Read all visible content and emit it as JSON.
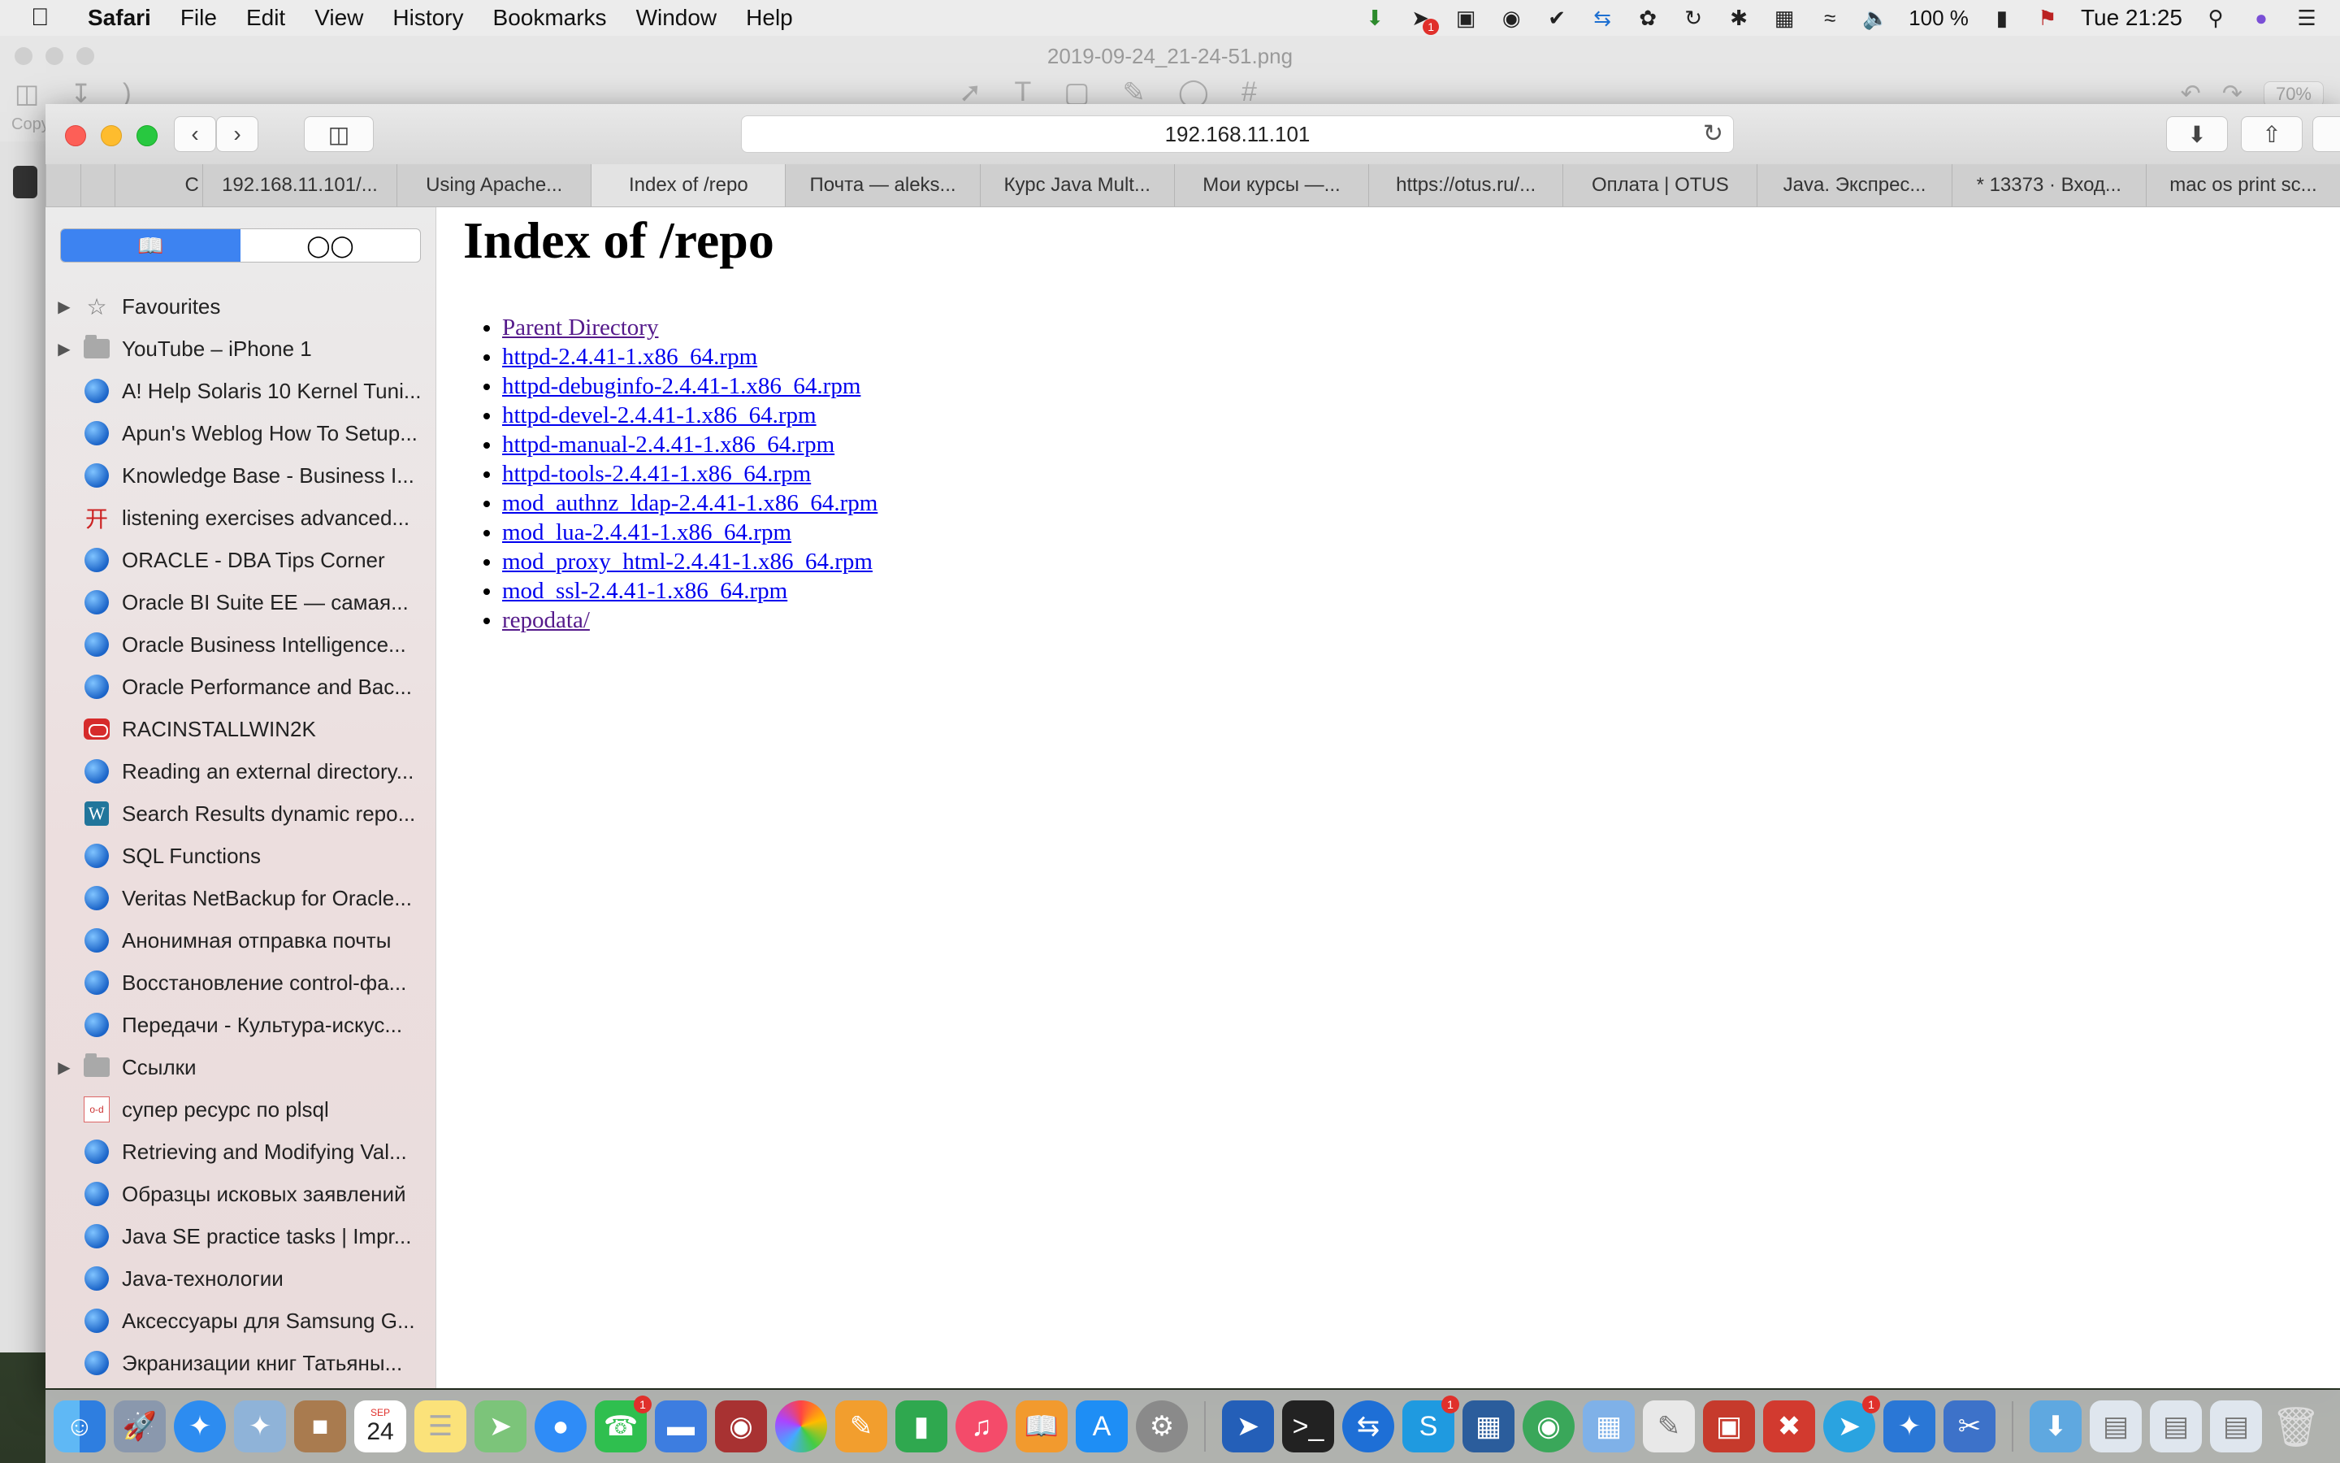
{
  "menubar": {
    "app": "Safari",
    "items": [
      "File",
      "Edit",
      "View",
      "History",
      "Bookmarks",
      "Window",
      "Help"
    ],
    "battery": "100 %",
    "clock": "Tue 21:25",
    "notification_badge": "1"
  },
  "preview": {
    "title": "2019-09-24_21-24-51.png",
    "zoom": "70%",
    "copy_label": "Copy"
  },
  "safari": {
    "address": "192.168.11.101",
    "tabs": [
      "C",
      "192.168.11.101/...",
      "Using Apache...",
      "Index of /repo",
      "Почта — aleks...",
      "Курс Java Mult...",
      "Мои курсы —...",
      "https://otus.ru/...",
      "Оплата | OTUS",
      "Java. Экспрес...",
      "* 13373 · Вход...",
      "mac os print sc..."
    ],
    "active_tab_index": 3
  },
  "sidebar": {
    "items": [
      {
        "label": "Favourites",
        "icon": "star-icon",
        "expandable": true
      },
      {
        "label": "YouTube – iPhone 1",
        "icon": "folder-icon",
        "expandable": true
      },
      {
        "label": "A! Help Solaris 10 Kernel Tuni...",
        "icon": "globe-icon"
      },
      {
        "label": "Apun's Weblog How To Setup...",
        "icon": "globe-icon"
      },
      {
        "label": "Knowledge Base - Business I...",
        "icon": "globe-icon"
      },
      {
        "label": "listening exercises advanced...",
        "icon": "fr-icon"
      },
      {
        "label": "ORACLE - DBA Tips Corner",
        "icon": "globe-icon"
      },
      {
        "label": "Oracle BI Suite EE — самая...",
        "icon": "globe-icon"
      },
      {
        "label": "Oracle Business Intelligence...",
        "icon": "globe-icon"
      },
      {
        "label": "Oracle Performance and Bac...",
        "icon": "globe-icon"
      },
      {
        "label": "RACINSTALLWIN2K",
        "icon": "oracle-icon"
      },
      {
        "label": "Reading an external directory...",
        "icon": "globe-icon"
      },
      {
        "label": "Search Results dynamic repo...",
        "icon": "wordpress-icon"
      },
      {
        "label": "SQL Functions",
        "icon": "globe-icon"
      },
      {
        "label": "Veritas NetBackup for Oracle...",
        "icon": "globe-icon"
      },
      {
        "label": "Анонимная отправка почты",
        "icon": "globe-icon"
      },
      {
        "label": "Восстановление control-фа...",
        "icon": "globe-icon"
      },
      {
        "label": "Передачи - Культура-искус...",
        "icon": "globe-icon"
      },
      {
        "label": "Ссылки",
        "icon": "folder-icon",
        "expandable": true
      },
      {
        "label": "супер ресурс по plsql",
        "icon": "od-icon"
      },
      {
        "label": "Retrieving and Modifying Val...",
        "icon": "globe-icon"
      },
      {
        "label": "Образцы исковых заявлений",
        "icon": "globe-icon"
      },
      {
        "label": "Java SE practice tasks | Impr...",
        "icon": "globe-icon"
      },
      {
        "label": "Java-технологии",
        "icon": "globe-icon"
      },
      {
        "label": "Аксессуары для Samsung G...",
        "icon": "globe-icon"
      },
      {
        "label": "Экранизации книг Татьяны...",
        "icon": "globe-icon"
      }
    ]
  },
  "page": {
    "heading": "Index of /repo",
    "links": [
      {
        "text": "Parent Directory",
        "visited": true
      },
      {
        "text": "httpd-2.4.41-1.x86_64.rpm",
        "visited": false
      },
      {
        "text": "httpd-debuginfo-2.4.41-1.x86_64.rpm",
        "visited": false
      },
      {
        "text": "httpd-devel-2.4.41-1.x86_64.rpm",
        "visited": false
      },
      {
        "text": "httpd-manual-2.4.41-1.x86_64.rpm",
        "visited": false
      },
      {
        "text": "httpd-tools-2.4.41-1.x86_64.rpm",
        "visited": false
      },
      {
        "text": "mod_authnz_ldap-2.4.41-1.x86_64.rpm",
        "visited": false
      },
      {
        "text": "mod_lua-2.4.41-1.x86_64.rpm",
        "visited": false
      },
      {
        "text": "mod_proxy_html-2.4.41-1.x86_64.rpm",
        "visited": false
      },
      {
        "text": "mod_ssl-2.4.41-1.x86_64.rpm",
        "visited": false
      },
      {
        "text": "repodata/",
        "visited": true
      }
    ]
  },
  "dock": {
    "calendar_month": "SEP",
    "calendar_day": "24",
    "badges": {
      "messages": "1",
      "skype": "1",
      "telegram": "1"
    }
  },
  "colors": {
    "link": "#0000ee",
    "visited": "#551a8b",
    "segment_active": "#3d83f1"
  }
}
